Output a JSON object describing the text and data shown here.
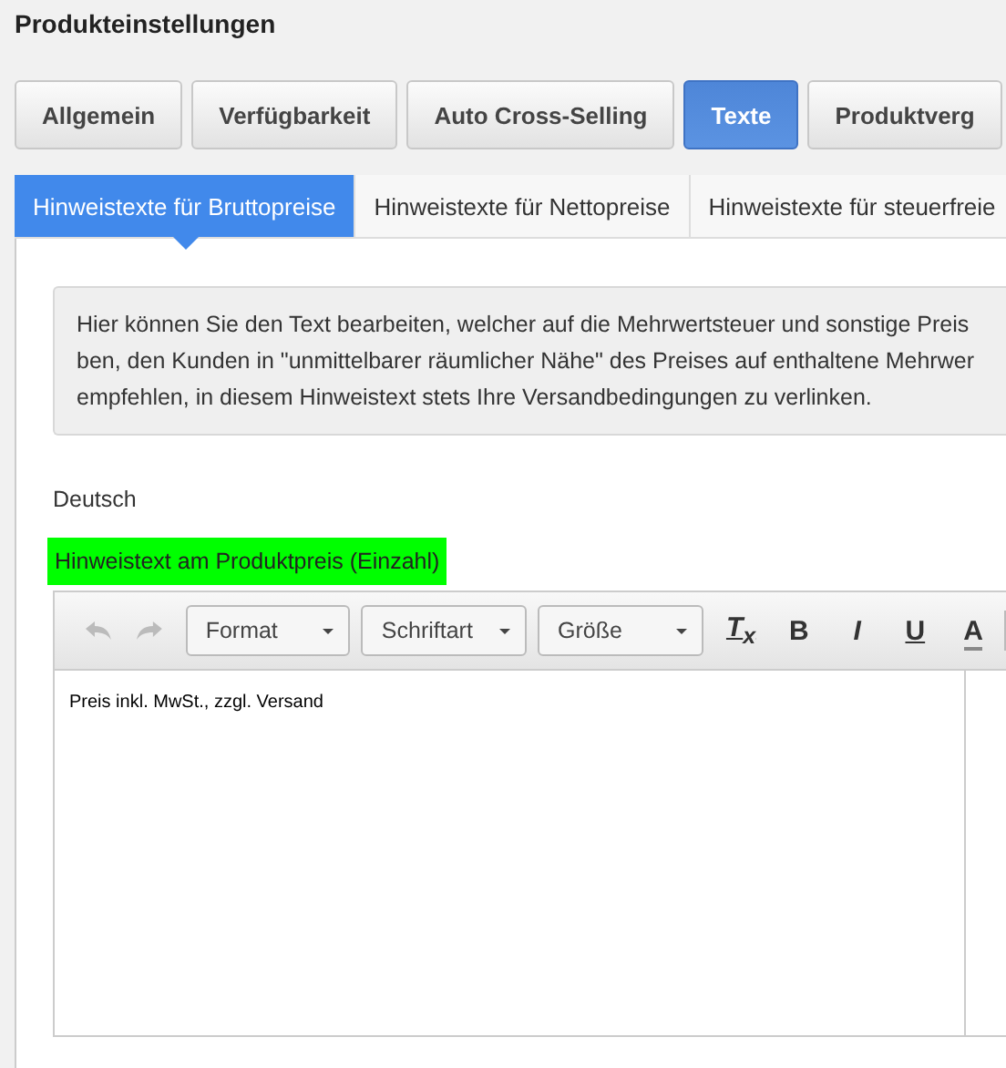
{
  "title": "Produkteinstellungen",
  "tabs": [
    {
      "label": "Allgemein",
      "selected": false
    },
    {
      "label": "Verfügbarkeit",
      "selected": false
    },
    {
      "label": "Auto Cross-Selling",
      "selected": false
    },
    {
      "label": "Texte",
      "selected": true
    },
    {
      "label": "Produktverg",
      "selected": false
    }
  ],
  "subtabs": [
    {
      "label": "Hinweistexte für Bruttopreise",
      "selected": true
    },
    {
      "label": "Hinweistexte für Nettopreise",
      "selected": false
    },
    {
      "label": "Hinweistexte für steuerfreie",
      "selected": false
    }
  ],
  "info": {
    "lines": [
      "Hier können Sie den Text bearbeiten, welcher auf die Mehrwertsteuer und sonstige Preis",
      "ben, den Kunden in \"unmittelbarer räumlicher Nähe\" des Preises auf enthaltene Mehrwer",
      "empfehlen, in diesem Hinweistext stets Ihre Versandbedingungen zu verlinken."
    ]
  },
  "language": "Deutsch",
  "field": {
    "label": "Hinweistext am Produktpreis (Einzahl)",
    "toolbar": {
      "history": [
        {
          "kind": "undo",
          "disabled": true
        },
        {
          "kind": "redo",
          "disabled": true
        }
      ],
      "dropdowns": [
        "Format",
        "Schriftart",
        "Größe"
      ],
      "tools": [
        {
          "kind": "clear-format",
          "glyph": "T$_{x}$"
        },
        {
          "kind": "bold",
          "glyph": "B"
        },
        {
          "kind": "italic",
          "glyph": "I"
        },
        {
          "kind": "underline",
          "glyph": "U"
        },
        {
          "kind": "text-color",
          "glyph": "A"
        }
      ]
    },
    "value": "Preis inkl. MwSt., zzgl. Versand"
  }
}
